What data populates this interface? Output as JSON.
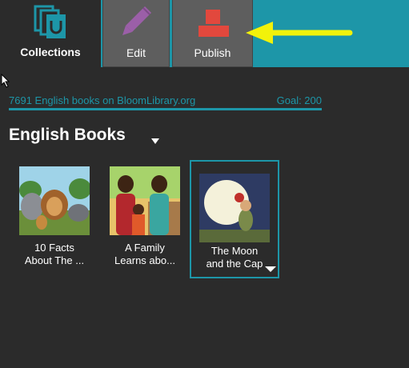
{
  "tabs": {
    "collections": {
      "label": "Collections",
      "icon": "collections-icon"
    },
    "edit": {
      "label": "Edit",
      "icon": "pencil-icon"
    },
    "publish": {
      "label": "Publish",
      "icon": "publish-icon"
    }
  },
  "stats": {
    "books_text": "7691 English books on BloomLibrary.org",
    "goal_text": "Goal: 200"
  },
  "collection": {
    "title": "English Books"
  },
  "books": [
    {
      "title_line1": "10 Facts",
      "title_line2": "About The ...",
      "selected": false
    },
    {
      "title_line1": "A Family",
      "title_line2": "Learns abo...",
      "selected": false
    },
    {
      "title_line1": "The Moon",
      "title_line2": "and the Cap",
      "selected": true
    }
  ],
  "colors": {
    "accent": "#1d96a8",
    "background": "#2b2b2b",
    "tab_inactive": "#5e5e5e",
    "pencil": "#9b5fa8",
    "publish": "#e2483d",
    "arrow": "#f2f20a"
  }
}
